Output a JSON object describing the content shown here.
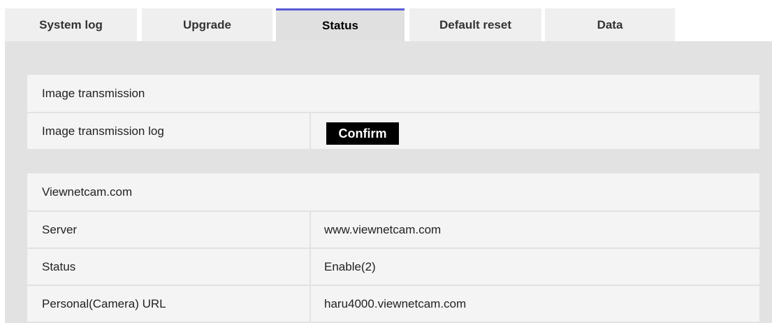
{
  "tabs": [
    {
      "label": "System log"
    },
    {
      "label": "Upgrade"
    },
    {
      "label": "Status",
      "active": true
    },
    {
      "label": "Default reset"
    },
    {
      "label": "Data"
    }
  ],
  "image_transmission": {
    "heading": "Image transmission",
    "log_label": "Image transmission log",
    "confirm_label": "Confirm"
  },
  "viewnetcam": {
    "heading": "Viewnetcam.com",
    "rows": [
      {
        "label": "Server",
        "value": "www.viewnetcam.com"
      },
      {
        "label": "Status",
        "value": "Enable(2)"
      },
      {
        "label": "Personal(Camera) URL",
        "value": "haru4000.viewnetcam.com"
      }
    ]
  },
  "colors": {
    "active_tab_accent": "#5a5ad6",
    "panel_background": "#e2e2e2",
    "button_background": "#000000"
  }
}
